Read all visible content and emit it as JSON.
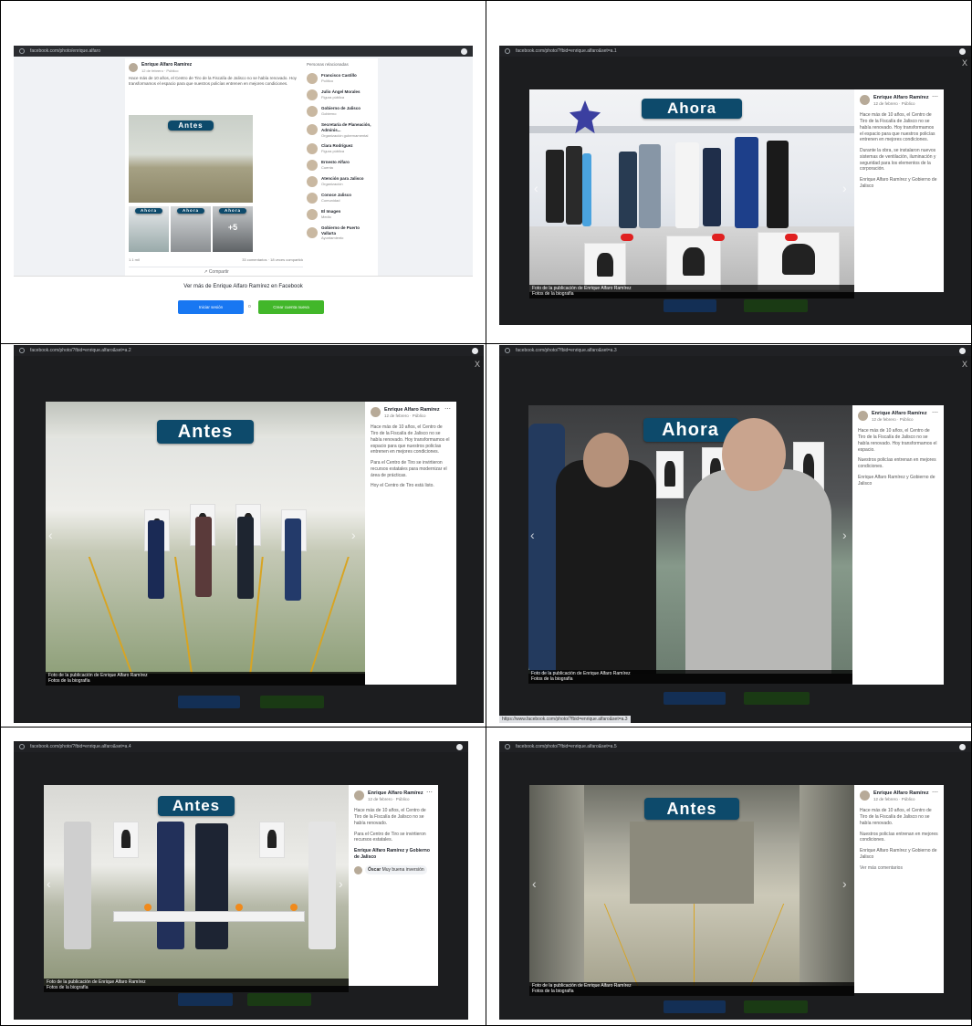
{
  "panels": [
    {
      "id": "p1",
      "url": "facebook.com/photo/enrique.alfaro",
      "author": "Enrique Alfaro Ramírez",
      "post_meta": "12 de febrero · Público",
      "post_text": "Hace más de 10 años, el Centro de Tiro de la Fiscalía de Jalisco no se había renovado. Hoy transformamos el espacio para que nuestros policías entrenen en mejores condiciones.",
      "sign_before": "Antes",
      "thumb_labels": [
        "Ahora",
        "Ahora",
        "Ahora"
      ],
      "thumb_more": "+5",
      "reactions": "1.1 mil",
      "comments": "33 comentarios · 18 veces compartido",
      "share": "Compartir",
      "suggest_title": "Personas relacionadas",
      "suggestions": [
        {
          "name": "Francisco Castillo",
          "sub": "Político"
        },
        {
          "name": "Julio Ángel Morales",
          "sub": "Figura pública"
        },
        {
          "name": "Gobierno de Jalisco",
          "sub": "Gobierno"
        },
        {
          "name": "Secretaría de Planeación, Adminis...",
          "sub": "Organización gubernamental"
        },
        {
          "name": "Clara Rodríguez",
          "sub": "Figura pública"
        },
        {
          "name": "Ernesto Alfaro",
          "sub": "Cuenta"
        },
        {
          "name": "Atención para Jalisco",
          "sub": "Organización"
        },
        {
          "name": "Conoce Jalisco",
          "sub": "Comunidad"
        },
        {
          "name": "El Imagen",
          "sub": "Medio"
        },
        {
          "name": "Gobierno de Puerto Vallarta",
          "sub": "Ayuntamiento"
        }
      ],
      "cta_title": "Ver más de Enrique Alfaro Ramírez en Facebook",
      "login_label": "Iniciar sesión",
      "or_label": "o",
      "create_label": "Crear cuenta nueva"
    },
    {
      "id": "p2",
      "url": "facebook.com/photo/?fbid=enrique.alfaro&set=a.1",
      "sign": "Ahora",
      "author": "Enrique Alfaro Ramírez",
      "meta": "12 de febrero · Público",
      "text1": "Hace más de 10 años, el Centro de Tiro de la Fiscalía de Jalisco no se había renovado. Hoy transformamos el espacio para que nuestros policías entrenen en mejores condiciones.",
      "text2": "Durante la obra, se instalaron nuevos sistemas de ventilación, iluminación y seguridad para los elementos de la corporación.",
      "text3": "Enrique Alfaro Ramírez y Gobierno de Jalisco",
      "caption1": "Foto de la publicación de Enrique Alfaro Ramírez",
      "caption2": "Fotos de la biografía",
      "close": "X"
    },
    {
      "id": "p3",
      "url": "facebook.com/photo/?fbid=enrique.alfaro&set=a.2",
      "sign": "Antes",
      "author": "Enrique Alfaro Ramírez",
      "meta": "12 de febrero · Público",
      "text1": "Hace más de 10 años, el Centro de Tiro de la Fiscalía de Jalisco no se había renovado. Hoy transformamos el espacio para que nuestros policías entrenen en mejores condiciones.",
      "text2": "Para el Centro de Tiro se invirtieron recursos estatales para modernizar el área de prácticas.",
      "text3": "Hoy el Centro de Tiro está listo.",
      "caption1": "Foto de la publicación de Enrique Alfaro Ramírez",
      "caption2": "Fotos de la biografía",
      "close": "X"
    },
    {
      "id": "p4",
      "url": "facebook.com/photo/?fbid=enrique.alfaro&set=a.3",
      "sign": "Ahora",
      "author": "Enrique Alfaro Ramírez",
      "meta": "12 de febrero · Público",
      "text1": "Hace más de 10 años, el Centro de Tiro de la Fiscalía de Jalisco no se había renovado. Hoy transformamos el espacio.",
      "text2": "Nuestros policías entrenan en mejores condiciones.",
      "text3": "Enrique Alfaro Ramírez y Gobierno de Jalisco",
      "caption1": "Foto de la publicación de Enrique Alfaro Ramírez",
      "caption2": "Fotos de la biografía",
      "status_url": "https://www.facebook.com/photo/?fbid=enrique.alfaro&set=a.3",
      "close": "X"
    },
    {
      "id": "p5",
      "url": "facebook.com/photo/?fbid=enrique.alfaro&set=a.4",
      "sign": "Antes",
      "author": "Enrique Alfaro Ramírez",
      "meta": "12 de febrero · Público",
      "text1": "Hace más de 10 años, el Centro de Tiro de la Fiscalía de Jalisco no se había renovado.",
      "text2": "Para el Centro de Tiro se invirtieron recursos estatales.",
      "reactions": "Enrique Alfaro Ramírez y Gobierno de Jalisco",
      "comment_author": "Óscar",
      "comment_text": "Muy buena inversión",
      "caption1": "Foto de la publicación de Enrique Alfaro Ramírez",
      "caption2": "Fotos de la biografía"
    },
    {
      "id": "p6",
      "url": "facebook.com/photo/?fbid=enrique.alfaro&set=a.5",
      "sign": "Antes",
      "author": "Enrique Alfaro Ramírez",
      "meta": "12 de febrero · Público",
      "text1": "Hace más de 10 años, el Centro de Tiro de la Fiscalía de Jalisco no se había renovado.",
      "text2": "Nuestros policías entrenan en mejores condiciones.",
      "text3": "Enrique Alfaro Ramírez y Gobierno de Jalisco",
      "more": "Ver más comentarios",
      "caption1": "Foto de la publicación de Enrique Alfaro Ramírez",
      "caption2": "Fotos de la biografía"
    }
  ]
}
